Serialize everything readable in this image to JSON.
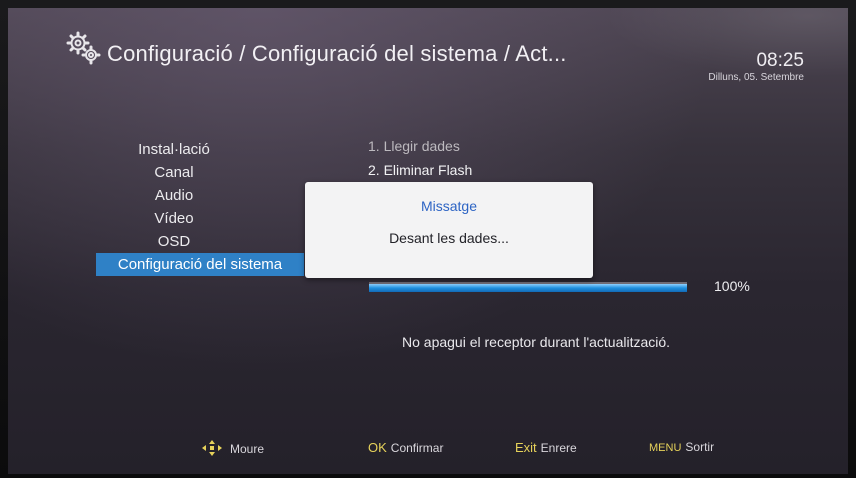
{
  "header": {
    "title": "Configuració / Configuració del sistema / Act...",
    "time": "08:25",
    "date": "Dilluns, 05. Setembre",
    "icon": "gear-icon"
  },
  "menu": {
    "items": [
      {
        "label": "Instal·lació"
      },
      {
        "label": "Canal"
      },
      {
        "label": "Audio"
      },
      {
        "label": "Vídeo"
      },
      {
        "label": "OSD"
      },
      {
        "label": "Configuració del sistema",
        "selected": true
      }
    ]
  },
  "update": {
    "steps": [
      {
        "label": "1. Llegir dades"
      },
      {
        "label": "2. Eliminar Flash"
      }
    ],
    "progress_percent": 100,
    "progress_label": "100%",
    "warning": "No apagui el receptor durant l'actualització."
  },
  "dialog": {
    "title": "Missatge",
    "message": "Desant les dades..."
  },
  "footer": {
    "hints": [
      {
        "key": "",
        "icon": "move-arrows-icon",
        "label": "Moure"
      },
      {
        "key": "OK",
        "label": "Confirmar"
      },
      {
        "key": "Exit",
        "label": "Enrere"
      },
      {
        "key": "MENU",
        "label": "Sortir"
      }
    ]
  },
  "colors": {
    "accent": "#2f81c6",
    "dialog_title": "#2d64c4",
    "hint_key": "#e6d25a",
    "progress": "#1f90df"
  }
}
